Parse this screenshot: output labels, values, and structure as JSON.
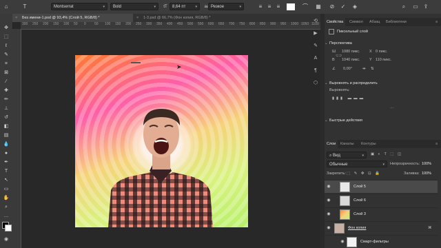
{
  "options_bar": {
    "font_family": "Montserrat",
    "font_style": "Bold",
    "font_size": "8,64 пт",
    "antialias": "Резкое"
  },
  "tabs": [
    {
      "label": "Без имени-1.psd @ 93,4% (Слой 5, RGB/8) *"
    },
    {
      "label": "1-3.psd @ 66,7% (Фон копия, RGB/8) *"
    }
  ],
  "rulers": {
    "h": [
      "300",
      "250",
      "200",
      "150",
      "100",
      "50",
      "0",
      "50",
      "100",
      "150",
      "200",
      "250",
      "300",
      "350",
      "400",
      "450",
      "500",
      "550",
      "600",
      "650",
      "700",
      "750",
      "800",
      "850",
      "900",
      "950",
      "1000",
      "1050",
      "1100"
    ]
  },
  "right_panel": {
    "tabs": [
      "Свойства",
      "Символ",
      "Абзац",
      "Библиотеки"
    ],
    "layer_kind": "Пиксельный слой",
    "transform": {
      "title": "Перспектива",
      "w": "1080 пикс.",
      "h": "1040 пикс.",
      "x": "0 пикс.",
      "y": "110 пикс.",
      "angle": "0,00°"
    },
    "align": {
      "title": "Выровнять и распределить",
      "label": "Выровнять:"
    },
    "quick": {
      "title": "Быстрые действия"
    }
  },
  "layers_panel": {
    "tabs": [
      "Слои",
      "Каналы",
      "Контуры"
    ],
    "search": "Вид",
    "blend_mode": "Обычные",
    "opacity_label": "Непрозрачность:",
    "opacity": "100%",
    "lock_label": "Закрепить:",
    "fill_label": "Заливка:",
    "fill": "100%",
    "layers": [
      {
        "name": "Слой 5",
        "selected": true
      },
      {
        "name": "Слой 6",
        "selected": false
      },
      {
        "name": "Слой 3",
        "selected": false
      },
      {
        "name": "Фон копия",
        "selected": false
      },
      {
        "name": "Смарт-фильтры",
        "selected": false
      }
    ]
  }
}
